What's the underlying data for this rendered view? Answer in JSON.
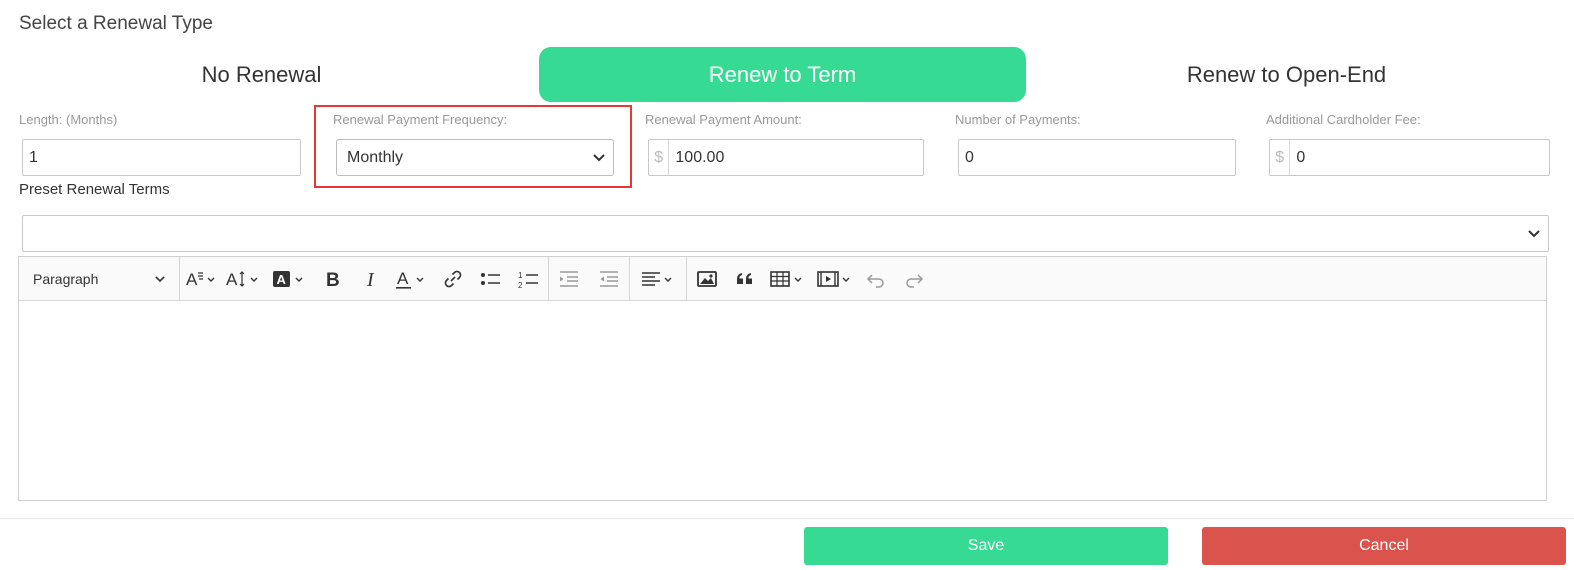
{
  "section_title": "Select a Renewal Type",
  "renewal_types": {
    "no_renewal": "No Renewal",
    "renew_to_term": "Renew to Term",
    "renew_to_open_end": "Renew to Open-End",
    "active": "renew_to_term"
  },
  "fields": {
    "length": {
      "label": "Length: (Months)",
      "value": "1"
    },
    "payment_frequency": {
      "label": "Renewal Payment Frequency:",
      "value": "Monthly"
    },
    "payment_amount": {
      "label": "Renewal Payment Amount:",
      "prefix": "$",
      "value": "100.00"
    },
    "number_of_payments": {
      "label": "Number of Payments:",
      "value": "0"
    },
    "additional_fee": {
      "label": "Additional Cardholder Fee:",
      "prefix": "$",
      "value": "0"
    }
  },
  "preset": {
    "label": "Preset Renewal Terms",
    "value": ""
  },
  "editor": {
    "paragraph_style": "Paragraph",
    "toolbar_icons": [
      "font-family-icon",
      "font-size-icon",
      "font-color-icon",
      "bold-icon",
      "italic-icon",
      "font-background-icon",
      "link-icon",
      "bulleted-list-icon",
      "numbered-list-icon",
      "outdent-icon",
      "indent-icon",
      "align-icon",
      "image-icon",
      "blockquote-icon",
      "table-icon",
      "media-icon",
      "undo-icon",
      "redo-icon"
    ],
    "content": ""
  },
  "buttons": {
    "save": "Save",
    "cancel": "Cancel"
  },
  "colors": {
    "accent_green": "#36da93",
    "cancel_red": "#db534d",
    "highlight_red": "#e53935"
  }
}
